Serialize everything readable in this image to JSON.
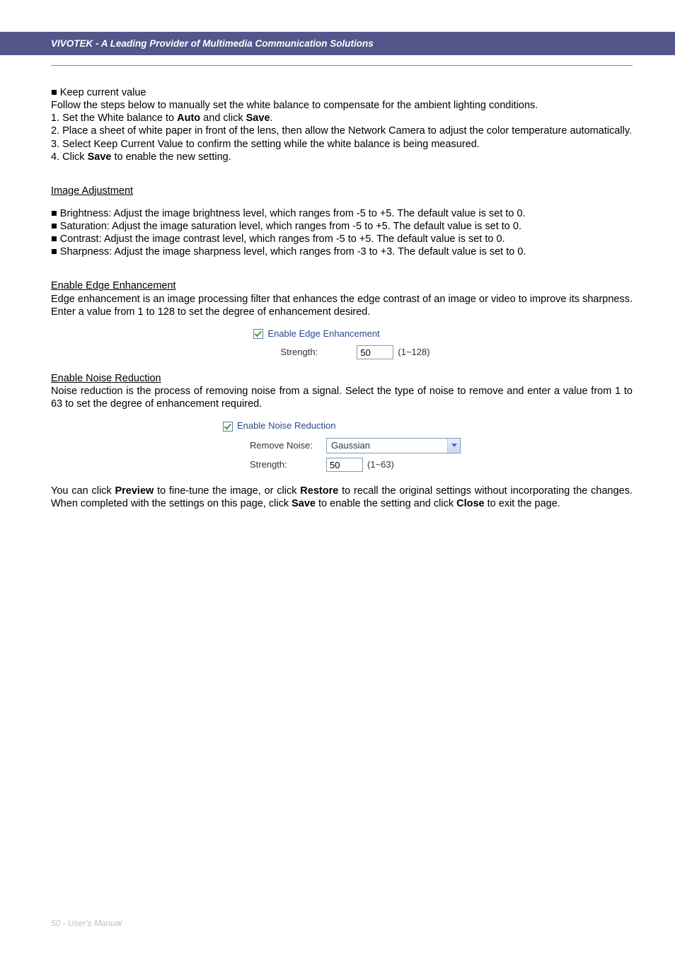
{
  "header": {
    "title": "VIVOTEK - A Leading Provider of Multimedia Communication Solutions"
  },
  "section_keep_current": {
    "bullet": "■ Keep current value",
    "intro": "Follow the steps below to manually set the white balance to compensate for the ambient lighting conditions.",
    "steps": {
      "s1_pre": "1. Set the White balance to ",
      "s1_b1": "Auto",
      "s1_mid": " and click ",
      "s1_b2": "Save",
      "s1_post": ".",
      "s2": "2. Place a sheet of white paper in front of the lens, then allow the Network Camera to adjust the color temperature automatically.",
      "s3": "3. Select Keep Current Value to confirm the setting while the white balance is being measured.",
      "s4_pre": "4. Click ",
      "s4_b": "Save",
      "s4_post": " to enable the new setting."
    }
  },
  "section_image_adj": {
    "heading": "Image Adjustment",
    "b1": "■ Brightness: Adjust the image brightness level, which ranges from -5 to +5. The default value is set to 0.",
    "b2": "■ Saturation: Adjust the image saturation level, which ranges from -5 to +5. The default value is set to 0.",
    "b3": "■ Contrast: Adjust the image contrast level, which ranges from -5 to +5. The default value is set to 0.",
    "b4": "■ Sharpness: Adjust the image sharpness level, which ranges from -3 to +3. The default value is set to 0."
  },
  "section_edge": {
    "heading": "Enable Edge Enhancement",
    "desc": "Edge enhancement is an image processing filter that enhances the edge contrast of an image or video to improve its sharpness. Enter a value from 1 to 128 to set the degree of enhancement desired.",
    "checkbox_label": "Enable Edge Enhancement",
    "strength_label": "Strength:",
    "strength_value": "50",
    "strength_range": "(1~128)"
  },
  "section_noise": {
    "heading": "Enable Noise Reduction",
    "desc": "Noise reduction is the process of removing noise from a signal. Select the type of noise to remove and enter a value from 1 to 63 to set the degree of enhancement required.",
    "checkbox_label": "Enable Noise Reduction",
    "remove_label": "Remove Noise:",
    "remove_value": "Gaussian",
    "strength_label": "Strength:",
    "strength_value": "50",
    "strength_range": "(1~63)"
  },
  "closing": {
    "pre1": "You can click ",
    "b1": "Preview",
    "mid1": " to fine-tune the image, or click ",
    "b2": "Restore",
    "mid2": " to recall the original settings without incorporating the changes. When completed with the settings on this page, click ",
    "b3": "Save",
    "mid3": " to enable the setting and click ",
    "b4": "Close",
    "post": " to exit the page."
  },
  "footer": {
    "text": "50 - User's Manual"
  }
}
